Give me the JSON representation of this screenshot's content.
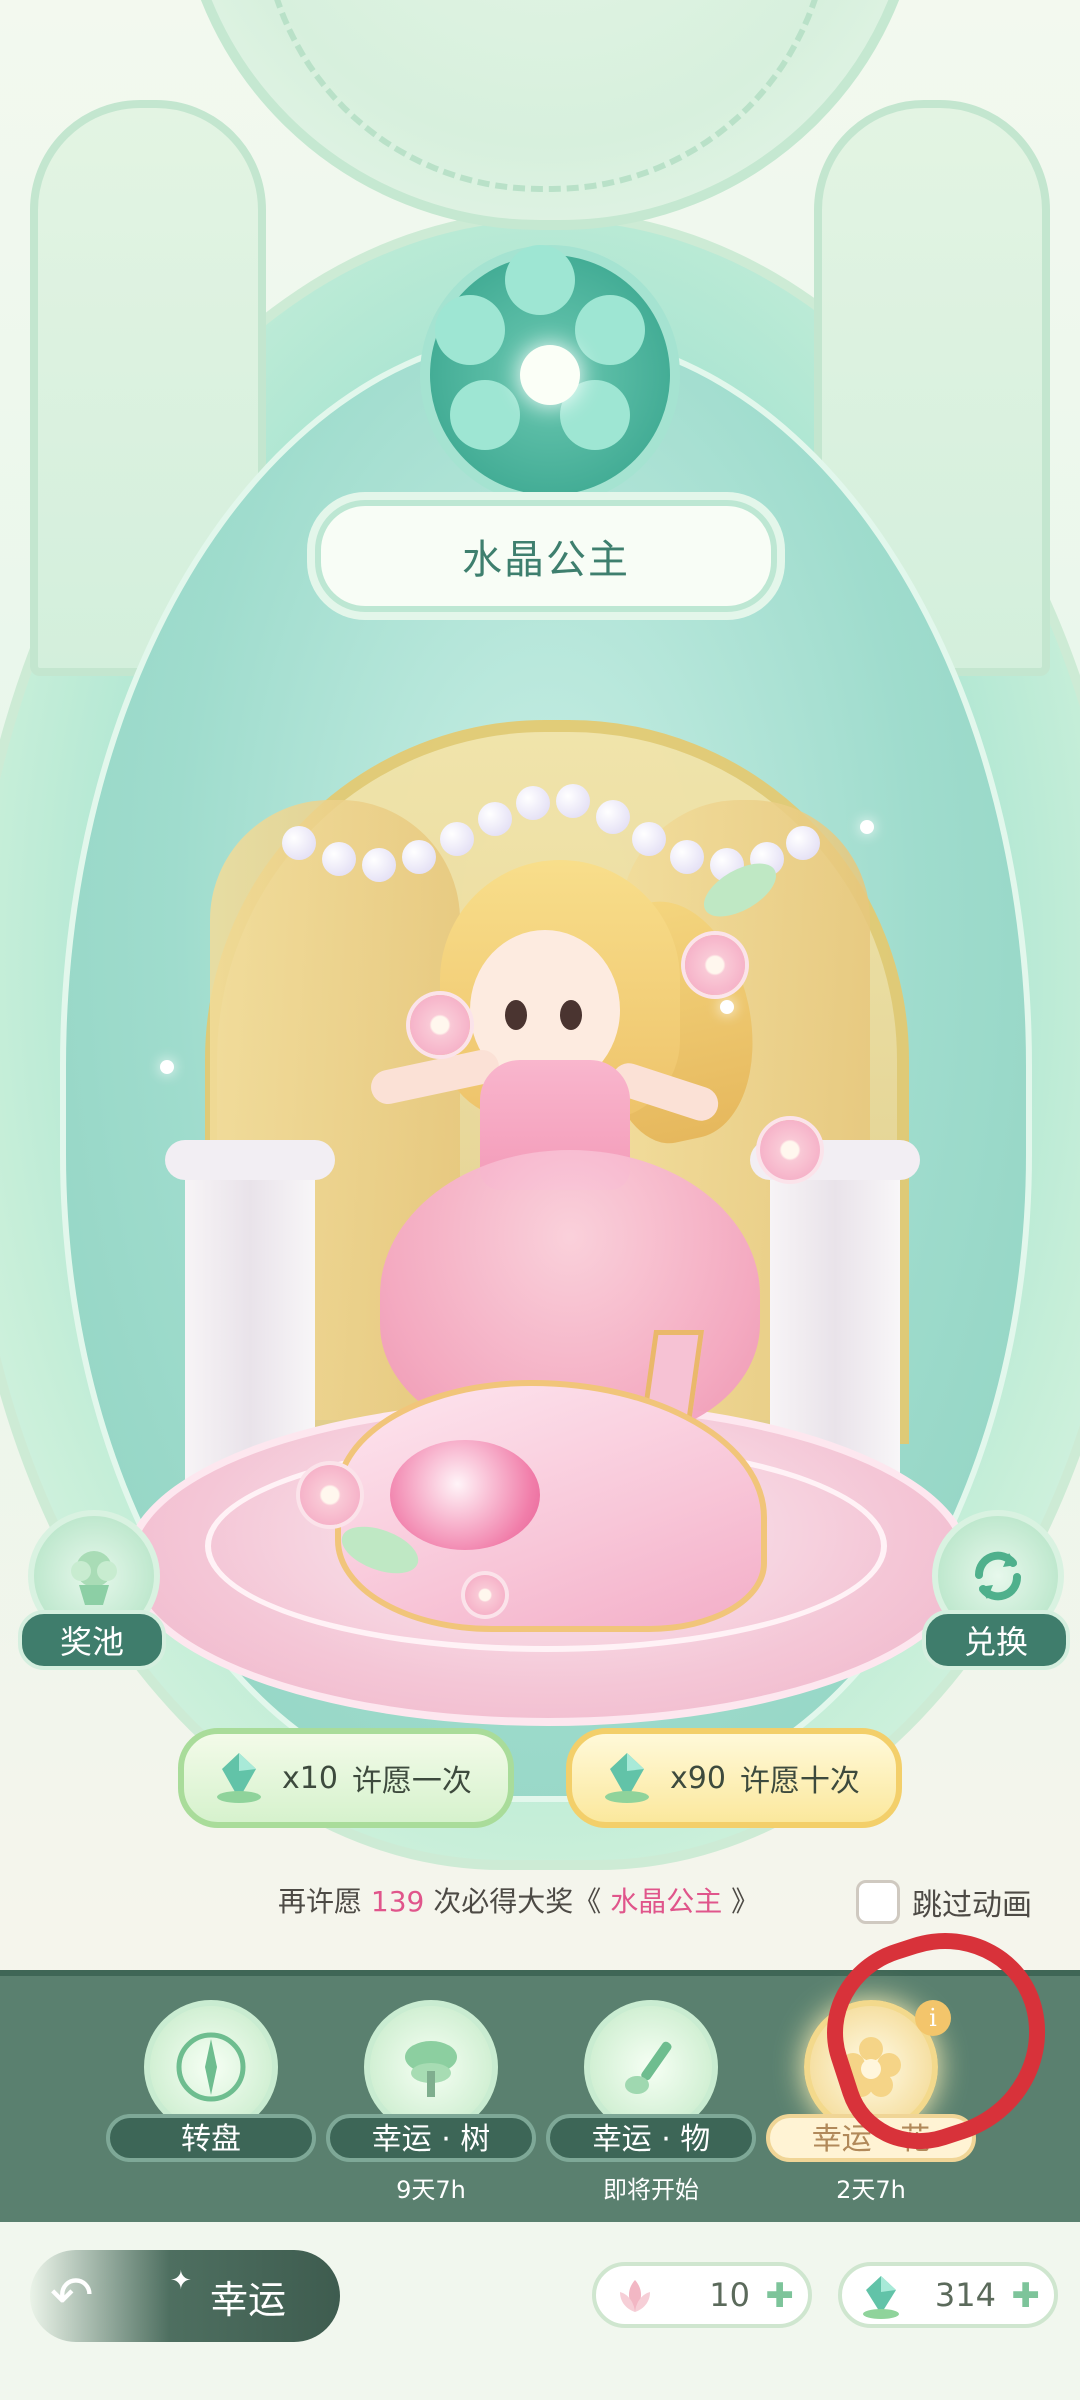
{
  "banner": {
    "title": "水晶公主"
  },
  "side_buttons": {
    "left_label": "奖池",
    "right_label": "兑换"
  },
  "wish": {
    "single": {
      "cost": "x10",
      "label": "许愿一次"
    },
    "ten": {
      "cost": "x90",
      "label": "许愿十次"
    }
  },
  "guarantee": {
    "prefix": "再许愿",
    "count": "139",
    "middle": "次必得大奖《",
    "prize": "水晶公主",
    "suffix": "》"
  },
  "skip_animation": {
    "label": "跳过动画",
    "checked": false
  },
  "tabs": [
    {
      "label": "转盘",
      "sub": "",
      "icon": "compass-icon"
    },
    {
      "label": "幸运 · 树",
      "sub": "9天7h",
      "icon": "tree-icon"
    },
    {
      "label": "幸运 · 物",
      "sub": "即将开始",
      "icon": "brush-icon"
    },
    {
      "label": "幸运 · 花",
      "sub": "2天7h",
      "icon": "flower-icon",
      "active": true
    }
  ],
  "info_badge": "i",
  "footer": {
    "back_label": "幸运",
    "currencies": [
      {
        "icon": "flower-token-icon",
        "value": "10"
      },
      {
        "icon": "green-gem-icon",
        "value": "314"
      }
    ]
  },
  "colors": {
    "accent": "#3f7d6c",
    "highlight": "#e0558b",
    "annotation": "#d8323a"
  }
}
